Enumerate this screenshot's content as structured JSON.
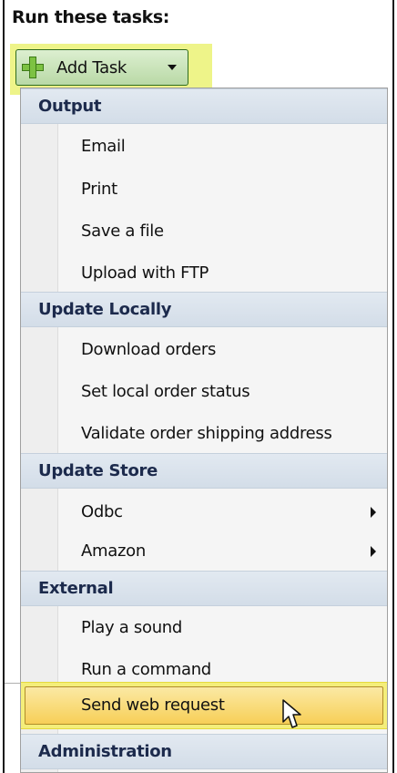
{
  "header": {
    "title": "Run these tasks:"
  },
  "add_task_button": {
    "label": "Add Task",
    "icon": "green-plus-icon",
    "dropdown_icon": "chevron-down-icon"
  },
  "menu": {
    "groups": [
      {
        "header": "Output",
        "items": [
          {
            "label": "Email"
          },
          {
            "label": "Print"
          },
          {
            "label": "Save a file"
          },
          {
            "label": "Upload with FTP"
          }
        ]
      },
      {
        "header": "Update Locally",
        "items": [
          {
            "label": "Download orders"
          },
          {
            "label": "Set local order status"
          },
          {
            "label": "Validate order shipping address"
          }
        ]
      },
      {
        "header": "Update Store",
        "items": [
          {
            "label": "Odbc",
            "has_submenu": true
          },
          {
            "label": "Amazon",
            "has_submenu": true
          }
        ]
      },
      {
        "header": "External",
        "items": [
          {
            "label": "Play a sound"
          },
          {
            "label": "Run a command"
          },
          {
            "label": "Send web request",
            "hovered": true
          }
        ]
      },
      {
        "header": "Administration",
        "items": []
      }
    ]
  },
  "colors": {
    "highlight": "#eef489",
    "group_header_text": "#1c2a4c",
    "hover_item": "#f7cf57"
  }
}
